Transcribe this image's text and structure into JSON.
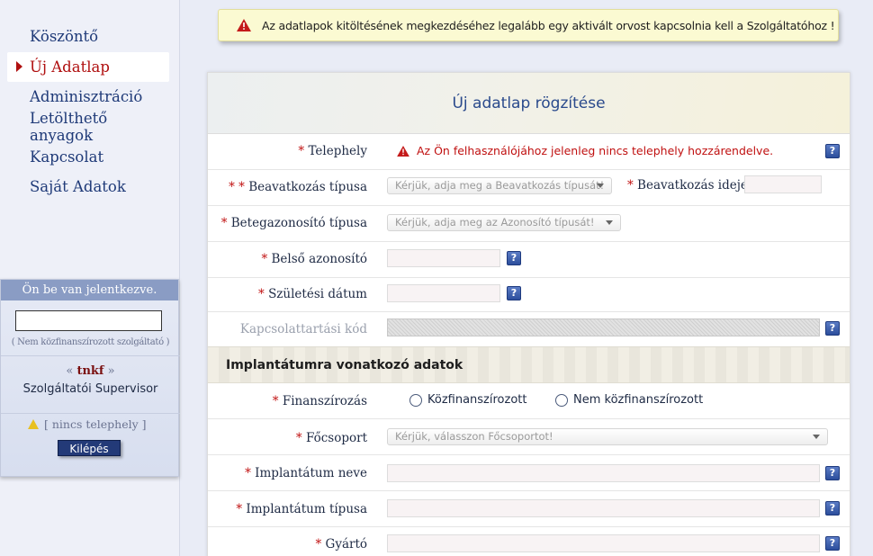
{
  "nav": {
    "items": [
      {
        "label": "Köszöntő"
      },
      {
        "label": "Új Adatlap"
      },
      {
        "label": "Adminisztráció"
      },
      {
        "label": "Letölthető anyagok"
      },
      {
        "label": "Kapcsolat"
      },
      {
        "label": "Saját Adatok"
      }
    ],
    "active_index": 1
  },
  "login": {
    "header": "Ön be van jelentkezve.",
    "input_value": "",
    "note": "( Nem közfinanszírozott szolgáltató )",
    "user_prefix": "«",
    "user_name": "tnkf",
    "user_suffix": "»",
    "role": "Szolgáltatói Supervisor",
    "site_status": "[ nincs telephely ]",
    "logout_label": "Kilépés"
  },
  "alert": {
    "text": "Az adatlapok kitöltésének megkezdéséhez legalább egy aktivált orvost kapcsolnia kell a Szolgáltatóhoz !"
  },
  "form": {
    "title": "Új adatlap rögzítése",
    "telephely": {
      "req": "*",
      "label": "Telephely",
      "error": "Az Ön felhasználójához jelenleg nincs telephely hozzárendelve."
    },
    "beavatkozas_tipusa": {
      "req": "* *",
      "label": "Beavatkozás típusa",
      "placeholder": "Kérjük, adja meg a Beavatkozás típusát!"
    },
    "beavatkozas_ideje": {
      "req": "*",
      "label": "Beavatkozás ideje"
    },
    "betegazonosito_tipusa": {
      "req": "*",
      "label": "Betegazonosító típusa",
      "placeholder": "Kérjük, adja meg az Azonosító típusát!"
    },
    "belso_azonosito": {
      "req": "*",
      "label": "Belső azonosító"
    },
    "szuletesi_datum": {
      "req": "*",
      "label": "Születési dátum"
    },
    "kapcsolattartasi_kod": {
      "label": "Kapcsolattartási kód"
    },
    "section_title": "Implantátumra vonatkozó adatok",
    "finanszirozas": {
      "req": "*",
      "label": "Finanszírozás",
      "options": [
        "Közfinanszírozott",
        "Nem közfinanszírozott"
      ]
    },
    "focsoport": {
      "req": "*",
      "label": "Főcsoport",
      "placeholder": "Kérjük, válasszon Főcsoportot!"
    },
    "implantatum_neve": {
      "req": "*",
      "label": "Implantátum neve"
    },
    "implantatum_tipusa": {
      "req": "*",
      "label": "Implantátum típusa"
    },
    "gyarto": {
      "req": "*",
      "label": "Gyártó"
    },
    "help_glyph": "?"
  }
}
